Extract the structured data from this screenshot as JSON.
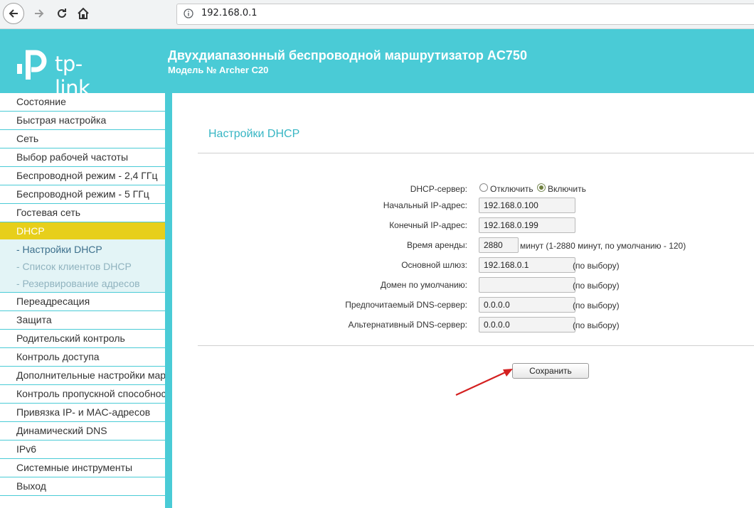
{
  "browser": {
    "url": "192.168.0.1"
  },
  "header": {
    "logo_text": "tp-link",
    "title": "Двухдиапазонный беспроводной маршрутизатор AC750",
    "model": "Модель № Archer C20",
    "bg_color": "#4acbd6"
  },
  "sidebar": {
    "items_before": [
      "Состояние",
      "Быстрая настройка",
      "Сеть",
      "Выбор рабочей частоты",
      "Беспроводной режим - 2,4 ГГц",
      "Беспроводной режим - 5 ГГц",
      "Гостевая сеть"
    ],
    "active": "DHCP",
    "submenu": [
      "- Настройки DHCP",
      "- Список клиентов DHCP",
      "- Резервирование адресов"
    ],
    "items_after": [
      "Переадресация",
      "Защита",
      "Родительский контроль",
      "Контроль доступа",
      "Дополнительные настройки маршрутизации",
      "Контроль пропускной способности",
      "Привязка IP- и MAC-адресов",
      "Динамический DNS",
      "IPv6",
      "Системные инструменты",
      "Выход"
    ],
    "active_color": "#e7cf1b"
  },
  "main": {
    "page_title": "Настройки DHCP",
    "dhcp_server": {
      "label": "DHCP-сервер:",
      "option_off": "Отключить",
      "option_on": "Включить",
      "selected": "Включить"
    },
    "start_ip": {
      "label": "Начальный IP-адрес:",
      "value": "192.168.0.100"
    },
    "end_ip": {
      "label": "Конечный IP-адрес:",
      "value": "192.168.0.199"
    },
    "lease": {
      "label": "Время аренды:",
      "value": "2880",
      "hint": "минут (1-2880 минут, по умолчанию - 120)"
    },
    "gateway": {
      "label": "Основной шлюз:",
      "value": "192.168.0.1",
      "hint": "(по выбору)"
    },
    "domain": {
      "label": "Домен по умолчанию:",
      "value": "",
      "hint": "(по выбору)"
    },
    "dns1": {
      "label": "Предпочитаемый DNS-сервер:",
      "value": "0.0.0.0",
      "hint": "(по выбору)"
    },
    "dns2": {
      "label": "Альтернативный DNS-сервер:",
      "value": "0.0.0.0",
      "hint": "(по выбору)"
    },
    "save_label": "Сохранить",
    "title_color": "#37b6c4",
    "arrow_color": "#d42020"
  }
}
